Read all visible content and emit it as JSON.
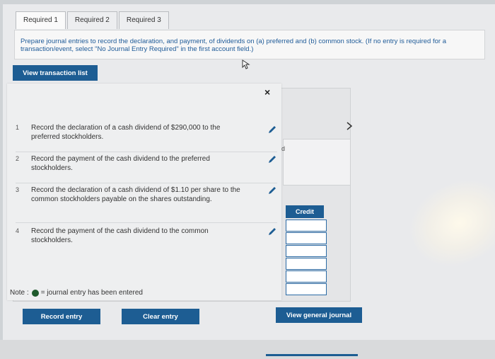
{
  "tabs": [
    "Required 1",
    "Required 2",
    "Required 3"
  ],
  "instruction": "Prepare journal entries to record the declaration, and payment, of dividends on (a) preferred and (b) common stock. (If no entry is required for a transaction/event, select \"No Journal Entry Required\" in the first account field.)",
  "buttons": {
    "view_transaction_list": "View transaction list",
    "record_entry": "Record entry",
    "clear_entry": "Clear entry",
    "view_general_journal": "View general journal"
  },
  "popup": {
    "close": "×",
    "items": [
      {
        "num": "1",
        "text": "Record the declaration of a cash dividend of $290,000 to the preferred stockholders."
      },
      {
        "num": "2",
        "text": "Record the payment of the cash dividend to the preferred stockholders."
      },
      {
        "num": "3",
        "text": "Record the declaration of a cash dividend of $1.10 per share to the common stockholders payable on the shares outstanding."
      },
      {
        "num": "4",
        "text": "Record the payment of the cash dividend to the common stockholders."
      }
    ]
  },
  "note": {
    "label": "Note :",
    "text": "= journal entry has been entered"
  },
  "journal": {
    "credit_header": "Credit",
    "partial_char": "d"
  },
  "colors": {
    "accent": "#1d5d93",
    "instruction_text": "#1f5b98",
    "entered_dot": "#1e5a2c"
  }
}
